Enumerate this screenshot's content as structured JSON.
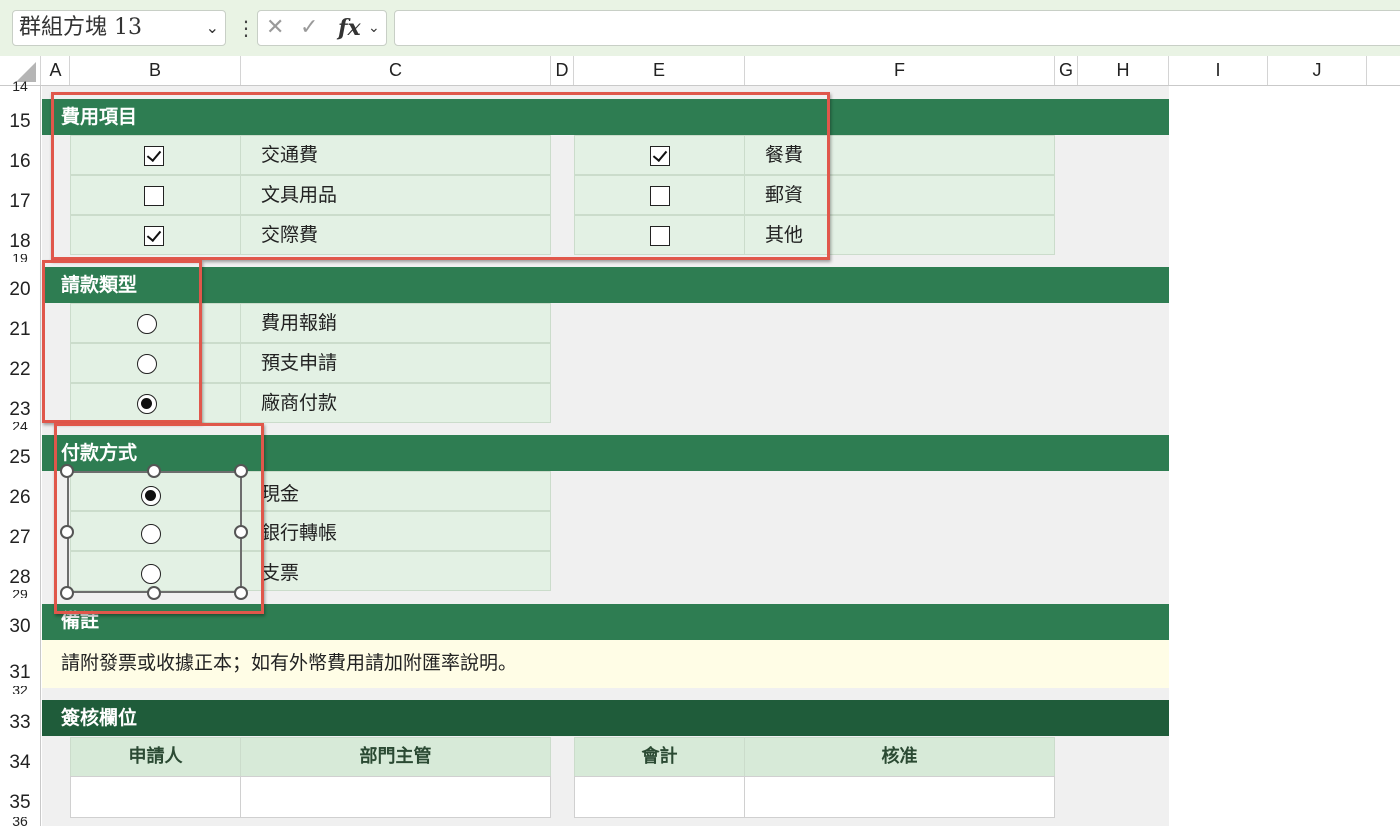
{
  "formula_bar": {
    "name_box": "群組方塊 13",
    "cancel_icon": "✕",
    "enter_icon": "✓",
    "fx_label": "fx",
    "formula": ""
  },
  "columns": [
    "A",
    "B",
    "C",
    "D",
    "E",
    "F",
    "G",
    "H",
    "I",
    "J"
  ],
  "rows": [
    "14",
    "15",
    "16",
    "17",
    "18",
    "19",
    "20",
    "21",
    "22",
    "23",
    "24",
    "25",
    "26",
    "27",
    "28",
    "29",
    "30",
    "31",
    "32",
    "33",
    "34",
    "35",
    "36"
  ],
  "sections": {
    "expense_items": {
      "title": "費用項目",
      "left": [
        {
          "label": "交通費",
          "checked": true
        },
        {
          "label": "文具用品",
          "checked": false
        },
        {
          "label": "交際費",
          "checked": true
        }
      ],
      "right": [
        {
          "label": "餐費",
          "checked": true
        },
        {
          "label": "郵資",
          "checked": false
        },
        {
          "label": "其他",
          "checked": false
        }
      ]
    },
    "request_type": {
      "title": "請款類型",
      "options": [
        {
          "label": "費用報銷",
          "selected": false
        },
        {
          "label": "預支申請",
          "selected": false
        },
        {
          "label": "廠商付款",
          "selected": true
        }
      ]
    },
    "payment_method": {
      "title": "付款方式",
      "options": [
        {
          "label": "現金",
          "selected": true
        },
        {
          "label": "銀行轉帳",
          "selected": false
        },
        {
          "label": "支票",
          "selected": false
        }
      ]
    },
    "remarks": {
      "title": "備註",
      "text": "請附發票或收據正本；如有外幣費用請加附匯率說明。"
    },
    "approval": {
      "title": "簽核欄位",
      "headers": [
        "申請人",
        "部門主管",
        "會計",
        "核准"
      ]
    }
  },
  "colors": {
    "band": "#2e7d52",
    "band_dark": "#1f5c3a",
    "cell_fill": "#e3f1e4",
    "note_fill": "#fffde6",
    "highlight_box": "#e0574b",
    "toolbar_bg": "#e9f3e4"
  }
}
